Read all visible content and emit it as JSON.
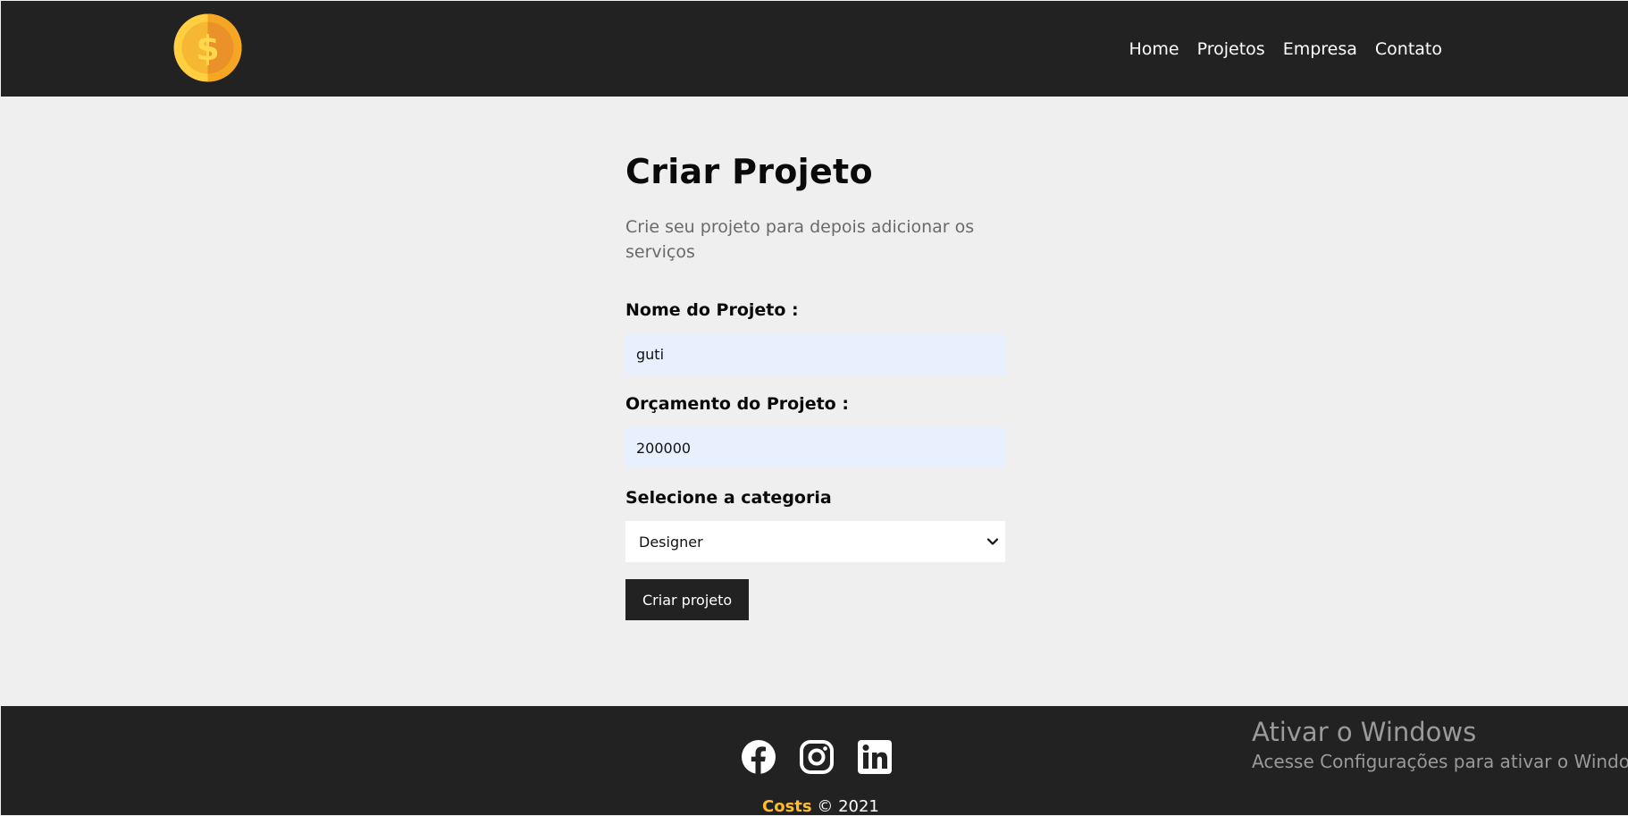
{
  "nav": {
    "logo_icon": "coin-dollar-icon",
    "links": [
      "Home",
      "Projetos",
      "Empresa",
      "Contato"
    ]
  },
  "main": {
    "title": "Criar Projeto",
    "subtitle": "Crie seu projeto para depois adicionar os serviços",
    "form": {
      "name_label": "Nome do Projeto :",
      "name_value": "guti",
      "budget_label": "Orçamento do Projeto :",
      "budget_value": "200000",
      "category_label": "Selecione a categoria",
      "category_selected": "Designer",
      "submit_label": "Criar projeto"
    }
  },
  "footer": {
    "social_icons": [
      "facebook-icon",
      "instagram-icon",
      "linkedin-icon"
    ],
    "brand": "Costs",
    "copyright": "© 2021"
  },
  "watermark": {
    "title": "Ativar o Windows",
    "subtitle": "Acesse Configurações para ativar o Windows."
  },
  "colors": {
    "dark": "#222222",
    "background": "#efefef",
    "accent": "#ffbb33",
    "autofill": "#e8f0fe"
  }
}
